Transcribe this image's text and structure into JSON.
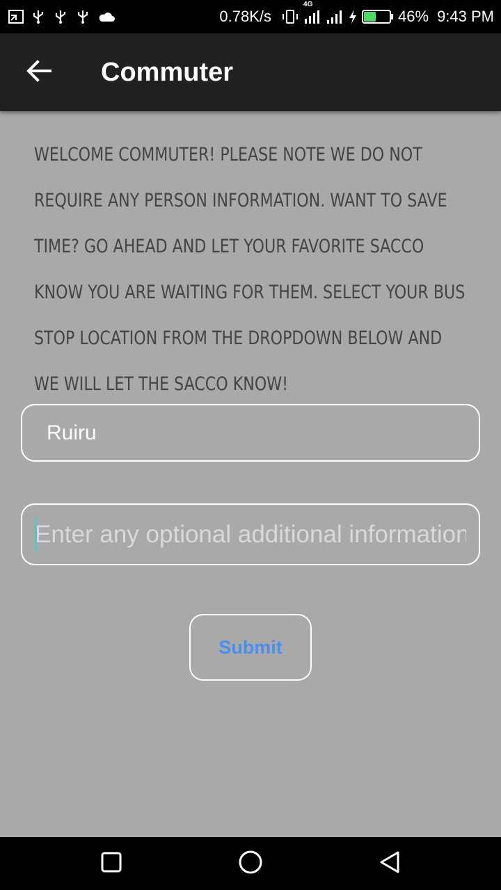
{
  "status_bar": {
    "net_speed": "0.78K/s",
    "network_type": "4G",
    "battery_percent": "46%",
    "time": "9:43 PM",
    "left_icons": [
      "screenshot-icon",
      "usb-icon",
      "usb-icon",
      "usb-icon",
      "cloud-icon"
    ],
    "right_icons": [
      "vibrate-icon",
      "signal-icon",
      "signal-icon",
      "charging-icon",
      "battery-icon"
    ],
    "battery_level": 0.46,
    "battery_color": "#4cd964"
  },
  "app_bar": {
    "title": "Commuter",
    "back_icon": "arrow-back-icon",
    "background": "#212121"
  },
  "intro_text": "Welcome commuter! Please note we do not require any person information. Want to save time? Go ahead and let your favorite sacco know you are waiting for them. Select your bus stop location from the dropdown below and we will let the sacco know!",
  "form": {
    "bus_stop_value": "Ruiru",
    "additional_info_placeholder": "Enter any optional additional information",
    "additional_info_value": "",
    "submit_label": "Submit",
    "submit_color": "#4a8ff0"
  },
  "nav_bar": {
    "icons": [
      "recent-apps-icon",
      "home-icon",
      "back-icon"
    ]
  }
}
